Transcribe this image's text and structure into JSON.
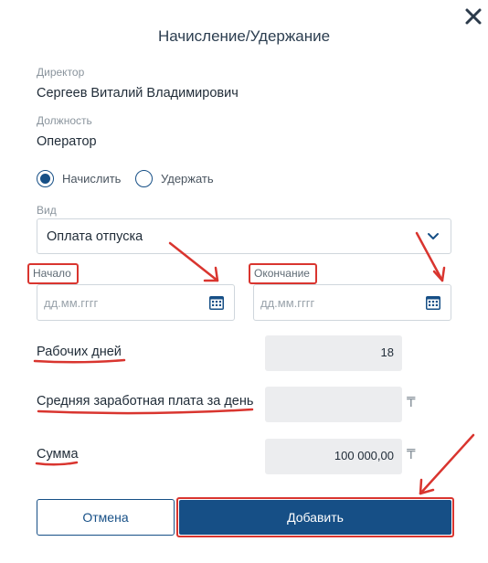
{
  "dialog": {
    "title": "Начисление/Удержание"
  },
  "director": {
    "label": "Директор",
    "value": "Сергеев Виталий Владимирович"
  },
  "position": {
    "label": "Должность",
    "value": "Оператор"
  },
  "operation": {
    "options": [
      {
        "label": "Начислить",
        "selected": true
      },
      {
        "label": "Удержать",
        "selected": false
      }
    ]
  },
  "type": {
    "label": "Вид",
    "value": "Оплата отпуска"
  },
  "dates": {
    "start_label": "Начало",
    "start_placeholder": "дд.мм.гггг",
    "end_label": "Окончание",
    "end_placeholder": "дд.мм.гггг"
  },
  "work_days": {
    "label": "Рабочих дней",
    "value": "18"
  },
  "avg_salary": {
    "label": "Средняя заработная плата за день",
    "value": "",
    "currency": "₸"
  },
  "amount": {
    "label": "Сумма",
    "value": "100 000,00",
    "currency": "₸"
  },
  "buttons": {
    "cancel": "Отмена",
    "add": "Добавить"
  },
  "colors": {
    "primary": "#164f86",
    "annotation": "#d9352f",
    "readonly_bg": "#ecedef"
  },
  "icons": {
    "close": "close-icon",
    "chevron": "chevron-down-icon",
    "calendar": "calendar-icon"
  }
}
